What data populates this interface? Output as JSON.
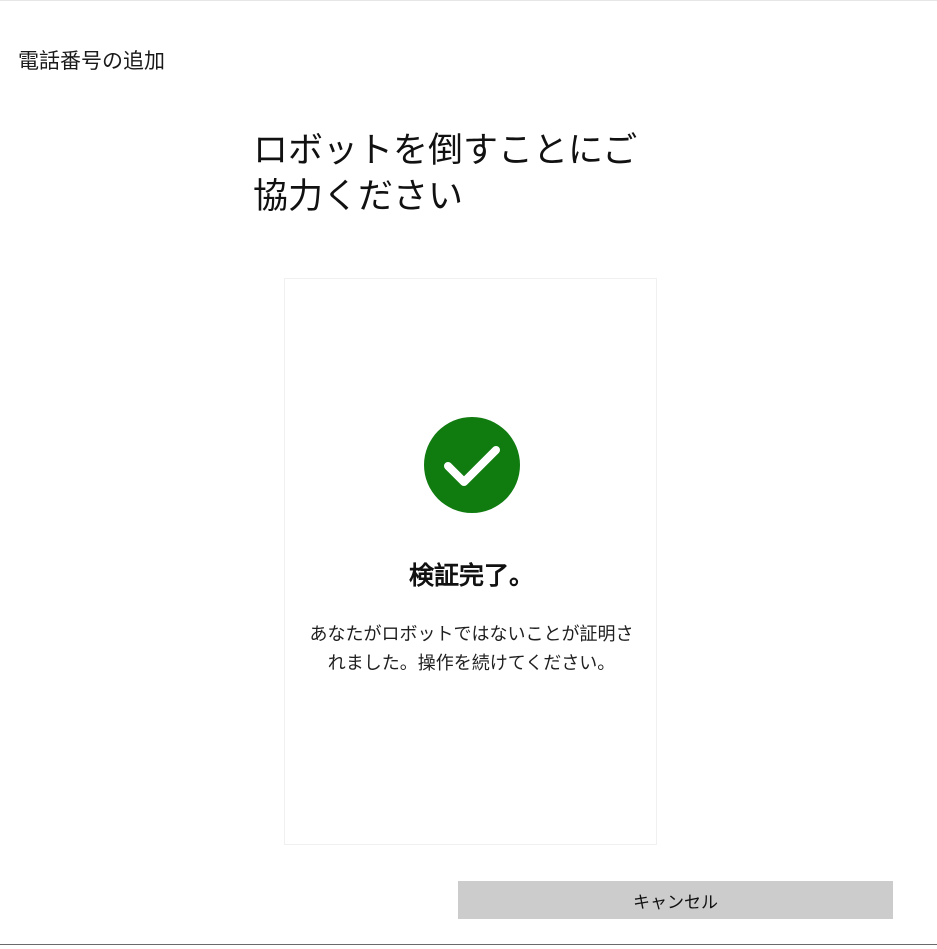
{
  "window": {
    "title": "電話番号の追加"
  },
  "main": {
    "heading": "ロボットを倒すことにご協力ください"
  },
  "verification": {
    "status_icon": "checkmark-circle-icon",
    "status_color": "#107C10",
    "title": "検証完了。",
    "message": "あなたがロボットではないことが証明されました。操作を続けてください。"
  },
  "footer": {
    "cancel_label": "キャンセル"
  }
}
